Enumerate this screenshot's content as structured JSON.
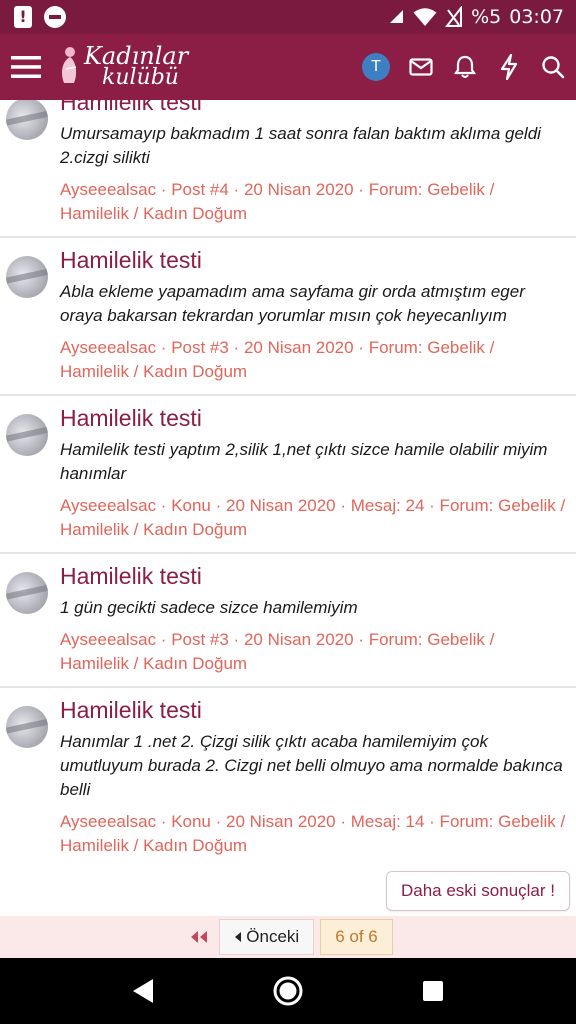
{
  "status_bar": {
    "battery": "%5",
    "time": "03:07"
  },
  "header": {
    "logo_line1": "Kadınlar",
    "logo_line2": "kulübü",
    "avatar_letter": "T",
    "icons": [
      "menu-icon",
      "mail-icon",
      "bell-icon",
      "lightning-icon",
      "search-icon"
    ],
    "brand_color": "#8c1d45"
  },
  "results": [
    {
      "title": "Hamilelik testi",
      "snippet": "Umursamayıp bakmadım 1 saat sonra falan baktım aklıma geldi 2.cizgi silikti",
      "meta": "Ayseeealsac · Post #4 · 20 Nisan 2020 · Forum: Gebelik / Hamilelik / Kadın Doğum"
    },
    {
      "title": "Hamilelik testi",
      "snippet": "Abla ekleme yapamadım ama sayfama gir orda atmıştım eger oraya bakarsan tekrardan yorumlar mısın çok heyecanlıyım",
      "meta": "Ayseeealsac · Post #3 · 20 Nisan 2020 · Forum: Gebelik / Hamilelik / Kadın Doğum"
    },
    {
      "title": "Hamilelik testi",
      "snippet": "Hamilelik testi yaptım 2,silik 1,net çıktı sizce hamile olabilir miyim hanımlar",
      "meta": "Ayseeealsac · Konu · 20 Nisan 2020 · Mesaj: 24 · Forum: Gebelik / Hamilelik / Kadın Doğum"
    },
    {
      "title": "Hamilelik testi",
      "snippet": "1 gün gecikti sadece sizce hamilemiyim",
      "meta": "Ayseeealsac · Post #3 · 20 Nisan 2020 · Forum: Gebelik / Hamilelik / Kadın Doğum"
    },
    {
      "title": "Hamilelik testi",
      "snippet": "Hanımlar 1 .net 2. Çizgi silik çıktı acaba hamilemiyim çok umutluyum burada 2. Cizgi net belli olmuyo ama normalde bakınca belli",
      "meta": "Ayseeealsac · Konu · 20 Nisan 2020 · Mesaj: 14 · Forum: Gebelik / Hamilelik / Kadın Doğum"
    }
  ],
  "older_button": "Daha eski sonuçlar !",
  "pagination": {
    "prev_label": "Önceki",
    "current": "6 of 6"
  }
}
